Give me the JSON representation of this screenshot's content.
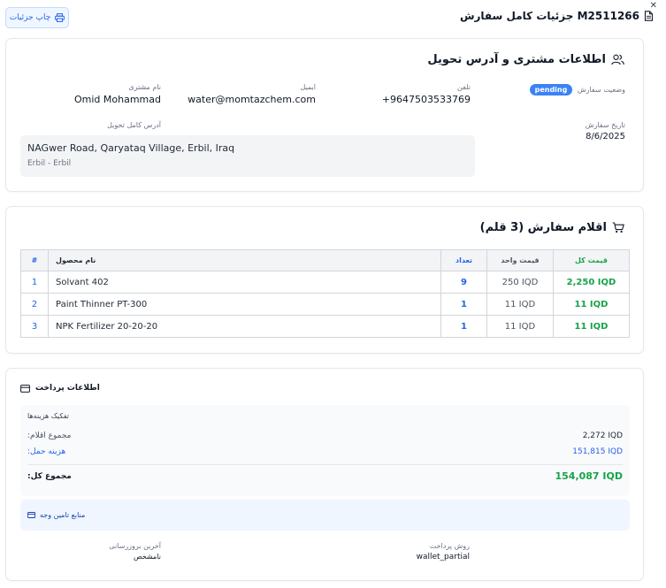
{
  "header": {
    "title": "جزئیات کامل سفارش M2511266",
    "print_label": "چاپ جزئیات"
  },
  "customer": {
    "section_title": "اطلاعات مشتری و آدرس تحویل",
    "name_label": "نام مشتری",
    "name": "Omid Mohammad",
    "email_label": "ایمیل",
    "email": "water@momtazchem.com",
    "phone_label": "تلفن",
    "phone": "+9647503533769",
    "status_label": "وضعیت سفارش",
    "status": "pending",
    "address_label": "آدرس کامل تحویل",
    "address": "NAGwer Road, Qaryataq Village, Erbil, Iraq",
    "address_city": "Erbil - Erbil",
    "date_label": "تاریخ سفارش",
    "date": "8/6/2025"
  },
  "items": {
    "section_title": "اقلام سفارش (3 قلم)",
    "columns": {
      "index": "#",
      "name": "نام محصول",
      "qty": "تعداد",
      "unit_price": "قیمت واحد",
      "total": "قیمت کل"
    },
    "rows": [
      {
        "index": "1",
        "name": "Solvant 402",
        "qty": "9",
        "unit_price": "250 IQD",
        "total": "2,250 IQD"
      },
      {
        "index": "2",
        "name": "Paint Thinner PT-300",
        "qty": "1",
        "unit_price": "11 IQD",
        "total": "11 IQD"
      },
      {
        "index": "3",
        "name": "NPK Fertilizer 20-20-20",
        "qty": "1",
        "unit_price": "11 IQD",
        "total": "11 IQD"
      }
    ]
  },
  "payment": {
    "section_title": "اطلاعات پرداخت",
    "breakdown_title": "تفکیک هزینه‌ها",
    "subtotal_label": "مجموع اقلام:",
    "subtotal": "2,272 IQD",
    "shipping_label": "هزینه حمل:",
    "shipping": "151,815 IQD",
    "total_label": "مجموع کل:",
    "total": "154,087 IQD",
    "funding_label": "منابع تامین وجه",
    "last_update_label": "آخرین بروزرسانی",
    "last_update": "نامشخص",
    "method_label": "روش پرداخت",
    "method": "wallet_partial"
  },
  "colors": {
    "accent": "#2563eb",
    "success": "#16a34a",
    "badge": "#3b82f6"
  }
}
